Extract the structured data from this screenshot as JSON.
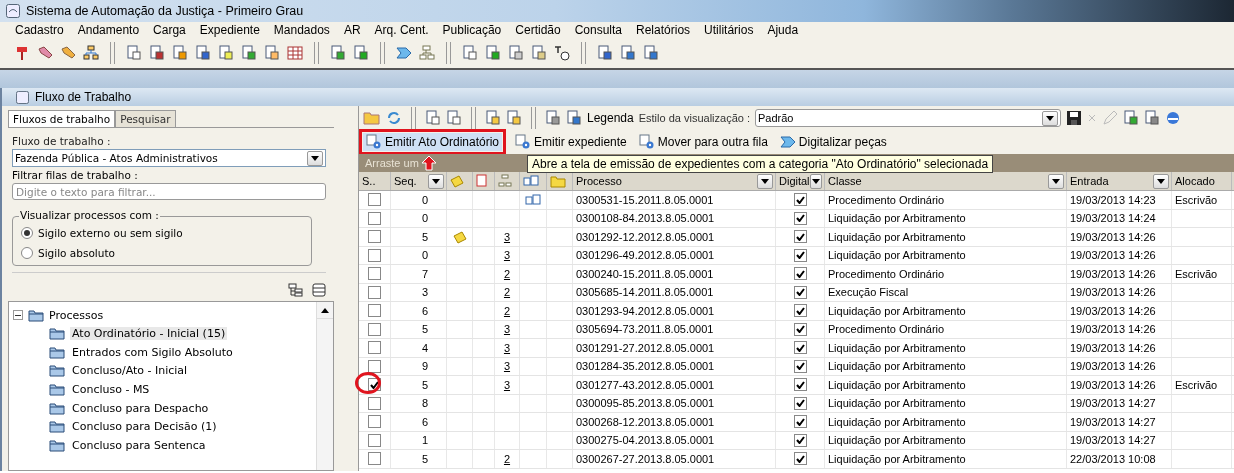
{
  "window": {
    "title": "Sistema de Automação da Justiça - Primeiro Grau"
  },
  "menu": [
    "Cadastro",
    "Andamento",
    "Carga",
    "Expediente",
    "Mandados",
    "AR",
    "Arq. Cent.",
    "Publicação",
    "Certidão",
    "Consulta",
    "Relatórios",
    "Utilitários",
    "Ajuda"
  ],
  "panel": {
    "title": "Fluxo de Trabalho"
  },
  "left": {
    "tabs": [
      {
        "label": "Fluxos de trabalho",
        "selected": true
      },
      {
        "label": "Pesquisar",
        "selected": false
      }
    ],
    "workflow_label": "Fluxo de trabalho :",
    "workflow_value": "Fazenda Pública - Atos Administrativos",
    "filter_label": "Filtrar filas de trabalho :",
    "filter_placeholder": "Digite o texto para filtrar...",
    "visibility": {
      "legend": "Visualizar processos com :",
      "options": [
        {
          "label": "Sigilo externo ou sem sigilo",
          "selected": true
        },
        {
          "label": "Sigilo absoluto",
          "selected": false
        }
      ]
    },
    "tree": [
      {
        "label": "Processos",
        "expanded": true,
        "children": [
          {
            "label": "Ato Ordinatório - Inicial (15)",
            "selected": true
          },
          {
            "label": "Entrados com Sigilo Absoluto",
            "selected": false
          },
          {
            "label": "Concluso/Ato - Inicial",
            "selected": false
          },
          {
            "label": "Concluso - MS",
            "selected": false
          },
          {
            "label": "Concluso para Despacho",
            "selected": false
          },
          {
            "label": "Concluso para Decisão (1)",
            "selected": false
          },
          {
            "label": "Concluso para Sentenca",
            "selected": false
          }
        ]
      }
    ]
  },
  "toolbar": {
    "legend": "Legenda",
    "style_label": "Estilo da visualização :",
    "style_value": "Padrão"
  },
  "actions": [
    {
      "label": "Emitir Ato Ordinatório",
      "highlighted": true
    },
    {
      "label": "Emitir expediente",
      "highlighted": false
    },
    {
      "label": "Mover para outra fila",
      "highlighted": false
    },
    {
      "label": "Digitalizar peças",
      "highlighted": false
    }
  ],
  "grid": {
    "group_hint": "Arraste um",
    "tooltip": "Abre a tela de emissão de expedientes com a categoria \"Ato Ordinatório\" selecionada",
    "columns": [
      "S..",
      "Seq.",
      "Processo",
      "Digital",
      "Classe",
      "Entrada",
      "Alocado"
    ],
    "rows": [
      {
        "selected": false,
        "seq": "0",
        "note": false,
        "linked": true,
        "processo": "0300531-15.2011.8.05.0001",
        "digital": true,
        "classe": "Procedimento Ordinário",
        "entrada": "19/03/2013 14:23",
        "alocado": "Escrivão"
      },
      {
        "selected": false,
        "seq": "0",
        "note": false,
        "linked": false,
        "processo": "0300108-84.2013.8.05.0001",
        "digital": true,
        "classe": "Liquidação por Arbitramento",
        "entrada": "19/03/2013 14:24"
      },
      {
        "selected": false,
        "seq": "5",
        "note": true,
        "count": "3",
        "linked": false,
        "processo": "0301292-12.2012.8.05.0001",
        "digital": true,
        "classe": "Liquidação por Arbitramento",
        "entrada": "19/03/2013 14:26"
      },
      {
        "selected": false,
        "seq": "0",
        "note": false,
        "count": "3",
        "linked": false,
        "processo": "0301296-49.2012.8.05.0001",
        "digital": true,
        "classe": "Liquidação por Arbitramento",
        "entrada": "19/03/2013 14:26"
      },
      {
        "selected": false,
        "seq": "7",
        "note": false,
        "count": "2",
        "linked": false,
        "processo": "0300240-15.2011.8.05.0001",
        "digital": true,
        "classe": "Procedimento Ordinário",
        "entrada": "19/03/2013 14:26",
        "alocado": "Escrivão"
      },
      {
        "selected": false,
        "seq": "3",
        "note": false,
        "count": "2",
        "linked": false,
        "processo": "0305685-14.2011.8.05.0001",
        "digital": true,
        "classe": "Execução Fiscal",
        "entrada": "19/03/2013 14:26"
      },
      {
        "selected": false,
        "seq": "6",
        "note": false,
        "count": "2",
        "linked": false,
        "processo": "0301293-94.2012.8.05.0001",
        "digital": true,
        "classe": "Liquidação por Arbitramento",
        "entrada": "19/03/2013 14:26"
      },
      {
        "selected": false,
        "seq": "5",
        "note": false,
        "count": "3",
        "linked": false,
        "processo": "0305694-73.2011.8.05.0001",
        "digital": true,
        "classe": "Procedimento Ordinário",
        "entrada": "19/03/2013 14:26"
      },
      {
        "selected": false,
        "seq": "4",
        "note": false,
        "count": "3",
        "linked": false,
        "processo": "0301291-27.2012.8.05.0001",
        "digital": true,
        "classe": "Liquidação por Arbitramento",
        "entrada": "19/03/2013 14:26"
      },
      {
        "selected": false,
        "seq": "9",
        "note": false,
        "count": "3",
        "linked": false,
        "processo": "0301284-35.2012.8.05.0001",
        "digital": true,
        "classe": "Liquidação por Arbitramento",
        "entrada": "19/03/2013 14:26"
      },
      {
        "selected": true,
        "circled": true,
        "seq": "5",
        "note": false,
        "count": "3",
        "linked": false,
        "processo": "0301277-43.2012.8.05.0001",
        "digital": true,
        "classe": "Liquidação por Arbitramento",
        "entrada": "19/03/2013 14:26",
        "alocado": "Escrivão"
      },
      {
        "selected": false,
        "seq": "8",
        "note": false,
        "linked": false,
        "processo": "0300095-85.2013.8.05.0001",
        "digital": true,
        "classe": "Liquidação por Arbitramento",
        "entrada": "19/03/2013 14:27"
      },
      {
        "selected": false,
        "seq": "6",
        "note": false,
        "linked": false,
        "processo": "0300268-12.2013.8.05.0001",
        "digital": true,
        "classe": "Liquidação por Arbitramento",
        "entrada": "19/03/2013 14:27"
      },
      {
        "selected": false,
        "seq": "1",
        "note": false,
        "linked": false,
        "processo": "0300275-04.2013.8.05.0001",
        "digital": true,
        "classe": "Liquidação por Arbitramento",
        "entrada": "19/03/2013 14:27"
      },
      {
        "selected": false,
        "seq": "5",
        "note": false,
        "count": "2",
        "linked": false,
        "processo": "0300267-27.2013.8.05.0001",
        "digital": true,
        "classe": "Liquidação por Arbitramento",
        "entrada": "22/03/2013 10:08"
      }
    ]
  }
}
